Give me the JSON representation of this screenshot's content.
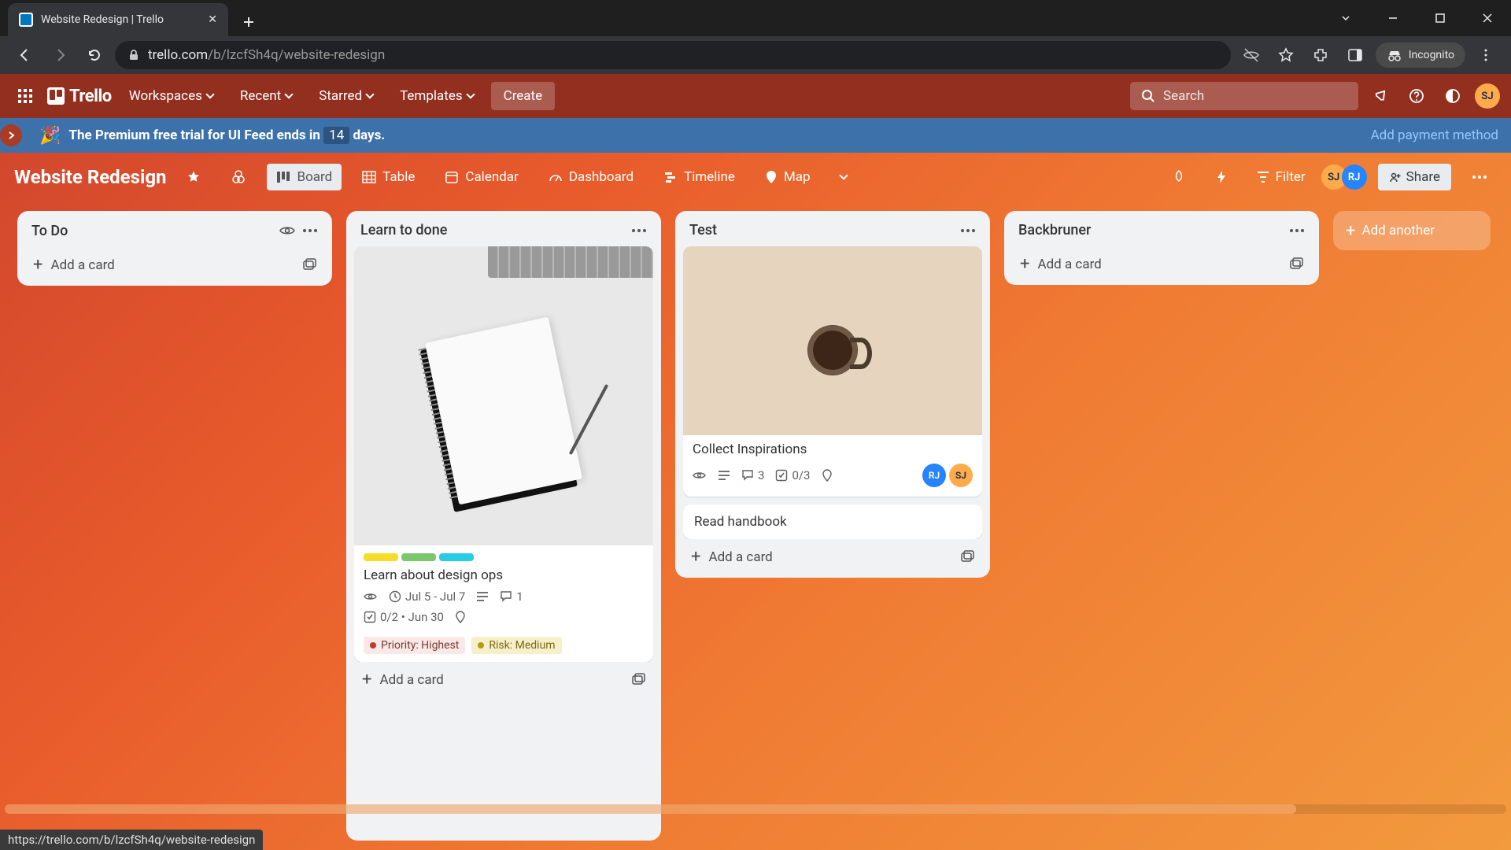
{
  "browser": {
    "tab_title": "Website Redesign | Trello",
    "url_host": "trello.com",
    "url_path": "/b/lzcfSh4q/website-redesign",
    "incognito_label": "Incognito"
  },
  "topnav": {
    "logo": "Trello",
    "items": [
      "Workspaces",
      "Recent",
      "Starred",
      "Templates"
    ],
    "create": "Create",
    "search_placeholder": "Search"
  },
  "promo": {
    "prefix": "The Premium free trial for UI Feed ends in",
    "days": "14",
    "suffix": "days.",
    "cta": "Add payment method"
  },
  "boardbar": {
    "title": "Website Redesign",
    "views": [
      {
        "name": "Board",
        "active": true
      },
      {
        "name": "Table",
        "active": false
      },
      {
        "name": "Calendar",
        "active": false
      },
      {
        "name": "Dashboard",
        "active": false
      },
      {
        "name": "Timeline",
        "active": false
      },
      {
        "name": "Map",
        "active": false
      }
    ],
    "filter": "Filter",
    "share": "Share",
    "avatars": [
      "SJ",
      "RJ"
    ]
  },
  "lists": [
    {
      "title": "To Do",
      "show_watch": true,
      "cards": [],
      "add_label": "Add a card"
    },
    {
      "title": "Learn to done",
      "cards": [
        {
          "cover": "notebook",
          "labels": [
            "l-yellow",
            "l-green",
            "l-teal"
          ],
          "title": "Learn about design ops",
          "badges": {
            "watch": true,
            "due": "Jul 5 - Jul 7",
            "description": true,
            "comments": "1",
            "checklist": "0/2 • Jun 30",
            "location": true
          },
          "custom_fields": [
            {
              "text": "Priority: Highest",
              "variant": ""
            },
            {
              "text": "Risk: Medium",
              "variant": "med"
            }
          ]
        }
      ],
      "add_label": "Add a card"
    },
    {
      "title": "Test",
      "cards": [
        {
          "cover": "coffee",
          "title": "Collect Inspirations",
          "badges": {
            "watch": true,
            "description": true,
            "comments": "3",
            "checklist": "0/3",
            "location": true
          },
          "members": [
            "RJ",
            "SJ"
          ]
        },
        {
          "title": "Read handbook"
        }
      ],
      "add_label": "Add a card"
    },
    {
      "title": "Backbruner",
      "cards": [],
      "add_label": "Add a card"
    }
  ],
  "add_list": "Add another",
  "status_url": "https://trello.com/b/lzcfSh4q/website-redesign"
}
